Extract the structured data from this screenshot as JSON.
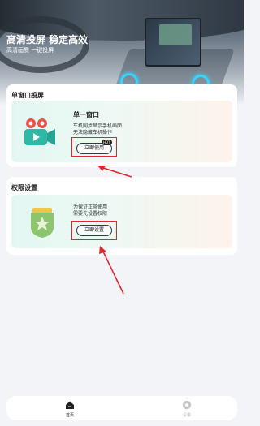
{
  "hero": {
    "title": "高清投屏 稳定高效",
    "subtitle": "高清画质 一键投屏"
  },
  "cards": [
    {
      "heading": "单窗口投屏",
      "panel_title": "单一窗口",
      "desc_line1": "车机同步显示手机画面",
      "desc_line2": "无法隐藏车机操作",
      "button": "立即使用",
      "badge": "HOT"
    },
    {
      "heading": "权限设置",
      "desc_line1": "为保证正常使用",
      "desc_line2": "需要先设置权限",
      "button": "立即设置"
    }
  ],
  "tabbar": {
    "items": [
      {
        "label": "首页",
        "icon": "home-icon",
        "active": true
      },
      {
        "label": "设置",
        "icon": "settings-icon",
        "active": false
      }
    ]
  },
  "colors": {
    "highlight_red": "#e0262d",
    "panel_mint": "#e3f7f2",
    "panel_peach": "#fdf3ea",
    "active_tab": "#222222",
    "inactive_tab": "#b5b9be"
  }
}
